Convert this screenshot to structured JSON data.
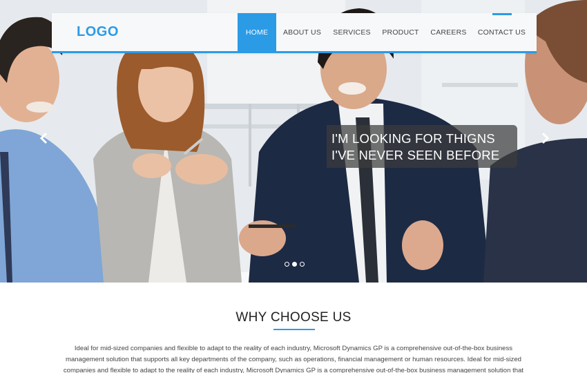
{
  "header": {
    "logo": "LOGO",
    "nav": [
      {
        "label": "HOME",
        "active": true
      },
      {
        "label": "ABOUT US",
        "active": false
      },
      {
        "label": "SERVICES",
        "active": false
      },
      {
        "label": "PRODUCT",
        "active": false
      },
      {
        "label": "CAREERS",
        "active": false
      },
      {
        "label": "CONTACT US",
        "active": false
      }
    ]
  },
  "slider": {
    "caption": "I'M LOOKING FOR THIGNS I'VE NEVER SEEN BEFORE",
    "slide_count": 3,
    "active_slide": 2,
    "prev_icon": "chevron-left-icon",
    "next_icon": "chevron-right-icon"
  },
  "why": {
    "title": "WHY CHOOSE US",
    "text": "Ideal for mid-sized companies and flexible to adapt to the reality of each industry, Microsoft Dynamics GP is a comprehensive out-of-the-box business management solution that supports all key departments of the company, such as operations, financial management or human resources. Ideal for mid-sized companies and flexible to adapt to the reality of each industry, Microsoft Dynamics GP is a comprehensive out-of-the-box business management solution that supports all key departments of the company."
  },
  "colors": {
    "accent": "#2b9be6",
    "nav_bg": "#f7f8f9",
    "caption_bg": "#3c3c3c"
  }
}
